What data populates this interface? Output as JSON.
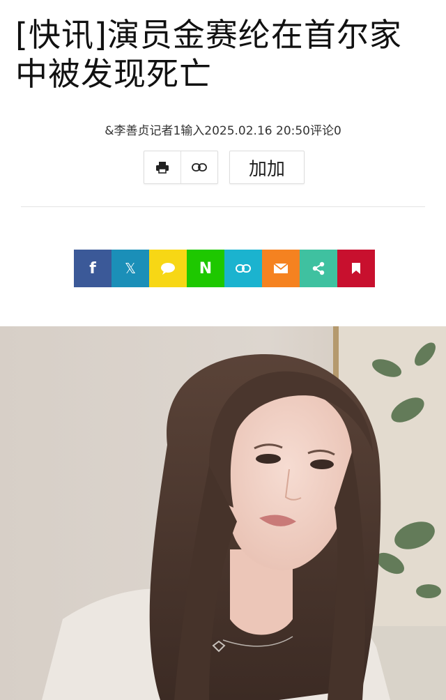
{
  "article": {
    "headline": "[快讯]演员金赛纶在首尔家中被发现死亡",
    "byline": "&李善贞记者1输入2025.02.16 20:50评论0"
  },
  "toolbar": {
    "print_icon": "print-icon",
    "link_icon": "link-icon",
    "font_size_label": "加加"
  },
  "share_buttons": [
    {
      "name": "facebook",
      "glyph": "f",
      "color": "#3b5998"
    },
    {
      "name": "x",
      "glyph": "𝕏",
      "color": "#1b8fb8"
    },
    {
      "name": "kakaotalk",
      "glyph": "",
      "color": "#f7d715"
    },
    {
      "name": "naver",
      "glyph": "N",
      "color": "#1ec800"
    },
    {
      "name": "copy-link",
      "glyph": "",
      "color": "#1bb3cf"
    },
    {
      "name": "email",
      "glyph": "",
      "color": "#f58220"
    },
    {
      "name": "share",
      "glyph": "",
      "color": "#3fc1a0"
    },
    {
      "name": "bookmark",
      "glyph": "",
      "color": "#c8102e"
    }
  ],
  "photo": {
    "subject": "portrait photo of a woman with long brown hair"
  }
}
